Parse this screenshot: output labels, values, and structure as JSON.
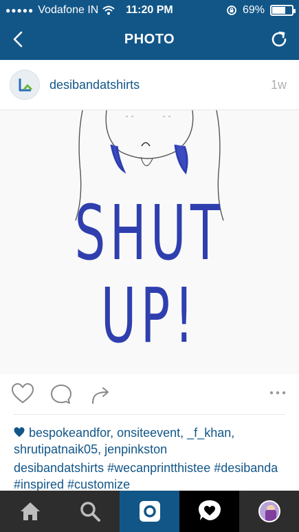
{
  "status_bar": {
    "carrier": "Vodafone IN",
    "time": "11:20 PM",
    "battery_percent": "69%",
    "battery_level": 0.69,
    "icons": [
      "signal-dots-icon",
      "wifi-icon",
      "orientation-lock-icon",
      "battery-icon"
    ]
  },
  "nav": {
    "title": "PHOTO",
    "back_icon": "chevron-left-icon",
    "refresh_icon": "refresh-icon"
  },
  "post": {
    "username": "desibandatshirts",
    "time_ago": "1w",
    "image_text": "SHUT UP!",
    "likes_text": "bespokeandfor, onsiteevent, _f_khan, shrutipatnaik05, jenpinkston",
    "caption_user": "desibandatshirts",
    "caption_text": "#wecanprintthistee #desibanda #inspired #customize"
  },
  "actions": [
    "heart-icon",
    "comment-icon",
    "share-icon",
    "more-icon"
  ],
  "tabbar": {
    "tabs": [
      "home-icon",
      "search-icon",
      "camera-icon",
      "activity-icon",
      "profile-avatar"
    ],
    "active": "camera"
  },
  "colors": {
    "brand_blue": "#125688",
    "tab_bar": "#2d2d2d",
    "ink_blue": "#2f3fae"
  }
}
